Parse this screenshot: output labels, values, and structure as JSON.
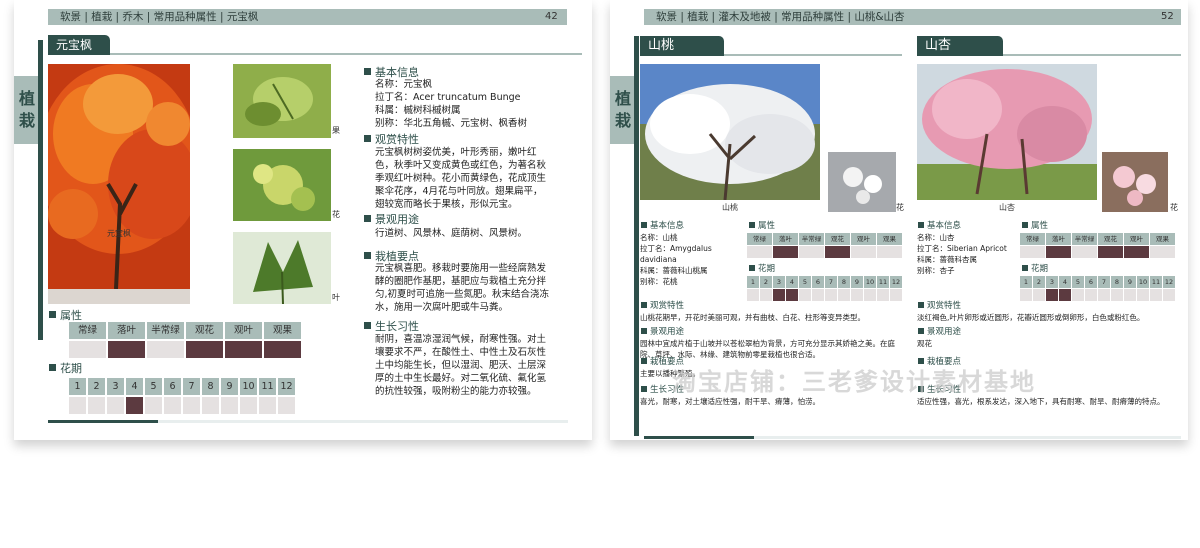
{
  "left_page": {
    "breadcrumb": "软景 | 植栽 | 乔木 | 常用品种属性 | 元宝枫",
    "page_number": "42",
    "side_tab": [
      "植",
      "栽"
    ],
    "title": "元宝枫",
    "main_caption": "元宝枫",
    "side_captions": [
      "果",
      "花",
      "叶"
    ],
    "sections": {
      "basic": {
        "heading": "基本信息",
        "lines": [
          "名称：元宝枫",
          "拉丁名：Acer truncatum Bunge",
          "科属：槭树科槭树属",
          "别称：华北五角槭、元宝树、枫香树"
        ]
      },
      "ornamental": {
        "heading": "观赏特性",
        "text": "元宝枫树树姿优美，叶形秀丽，嫩叶红色，秋季叶又变成黄色或红色，为著名秋季观红叶树种。花小而黄绿色，花成顶生聚伞花序，4月花与叶同放。翅果扁平，翅较宽而略长于果核，形似元宝。"
      },
      "landscape": {
        "heading": "景观用途",
        "text": "行道树、风景林、庭荫树、风景树。"
      },
      "planting": {
        "heading": "栽植要点",
        "text": "元宝枫喜肥。移栽时要施用一些经腐熟发酵的圈肥作基肥，基肥应与栽植土充分拌匀,初夏时可追施一些氮肥。秋末结合浇冻水，施用一次腐叶肥或牛马粪。"
      },
      "habit": {
        "heading": "生长习性",
        "text": "耐阴，喜温凉湿润气候，耐寒性强。对土壤要求不严，在酸性土、中性土及石灰性土中均能生长，但以湿润、肥沃、土层深厚的土中生长最好。对二氧化硫、氟化氢的抗性较强，吸附粉尘的能力亦较强。"
      }
    },
    "attributes": {
      "heading": "属性",
      "labels": [
        "常绿",
        "落叶",
        "半常绿",
        "观花",
        "观叶",
        "观果"
      ],
      "active": [
        false,
        true,
        false,
        true,
        true,
        true
      ]
    },
    "flowering": {
      "heading": "花期",
      "months": [
        "1",
        "2",
        "3",
        "4",
        "5",
        "6",
        "7",
        "8",
        "9",
        "10",
        "11",
        "12"
      ],
      "active": [
        false,
        false,
        false,
        true,
        false,
        false,
        false,
        false,
        false,
        false,
        false,
        false
      ]
    }
  },
  "right_page": {
    "breadcrumb": "软景 | 植栽 | 灌木及地被 | 常用品种属性 | 山桃&山杏",
    "page_number": "52",
    "side_tab": [
      "植",
      "栽"
    ],
    "plants": [
      {
        "title": "山桃",
        "main_caption": "山桃",
        "side_caption": "花",
        "basic_heading": "基本信息",
        "basic_lines": [
          "名称：山桃",
          "拉丁名：Amygdalus davidiana",
          "科属：蔷薇科山桃属",
          "别称：花桃"
        ],
        "attr_heading": "属性",
        "attr_labels": [
          "常绿",
          "落叶",
          "半常绿",
          "观花",
          "观叶",
          "观果"
        ],
        "attr_active": [
          false,
          true,
          false,
          true,
          false,
          false
        ],
        "flower_heading": "花期",
        "months": [
          "1",
          "2",
          "3",
          "4",
          "5",
          "6",
          "7",
          "8",
          "9",
          "10",
          "11",
          "12"
        ],
        "month_active": [
          false,
          false,
          true,
          true,
          false,
          false,
          false,
          false,
          false,
          false,
          false,
          false
        ],
        "sections": [
          {
            "heading": "观赏特性",
            "text": "山桃花期早，开花时美丽可观，并有曲枝、白花、柱形等变异类型。"
          },
          {
            "heading": "景观用途",
            "text": "园林中宜成片植于山坡并以苍松翠柏为背景，方可充分显示其娇艳之美。在庭院、草坪、水际、林缘、建筑物前零星栽植也很合适。"
          },
          {
            "heading": "栽植要点",
            "text": "主要以播种繁殖。"
          },
          {
            "heading": "生长习性",
            "text": "喜光，耐寒，对土壤适应性强，耐干旱、瘠薄，怕涝。"
          }
        ]
      },
      {
        "title": "山杏",
        "main_caption": "山杏",
        "side_caption": "花",
        "basic_heading": "基本信息",
        "basic_lines": [
          "名称：山杏",
          "拉丁名：Siberian Apricot",
          "科属：蔷薇科杏属",
          "别称：杏子"
        ],
        "attr_heading": "属性",
        "attr_labels": [
          "常绿",
          "落叶",
          "半常绿",
          "观花",
          "观叶",
          "观果"
        ],
        "attr_active": [
          false,
          true,
          false,
          true,
          true,
          false
        ],
        "flower_heading": "花期",
        "months": [
          "1",
          "2",
          "3",
          "4",
          "5",
          "6",
          "7",
          "8",
          "9",
          "10",
          "11",
          "12"
        ],
        "month_active": [
          false,
          false,
          true,
          true,
          false,
          false,
          false,
          false,
          false,
          false,
          false,
          false
        ],
        "sections": [
          {
            "heading": "观赏特性",
            "text": "淡红褐色,叶片卵形或近圆形，花瓣近圆形或倒卵形，白色或粉红色。"
          },
          {
            "heading": "景观用途",
            "text": "观花"
          },
          {
            "heading": "栽植要点",
            "text": ""
          },
          {
            "heading": "生长习性",
            "text": "适应性强，喜光，根系发达，深入地下，具有耐寒、耐旱、耐瘠薄的特点。"
          }
        ]
      }
    ]
  },
  "watermark": "淘宝店铺：三老爹设计素材基地",
  "colors": {
    "accent": "#2e4f4a",
    "light_accent": "#a9bcb8",
    "active_cell": "#5c3a40",
    "inactive_cell": "#e5e1e1"
  }
}
